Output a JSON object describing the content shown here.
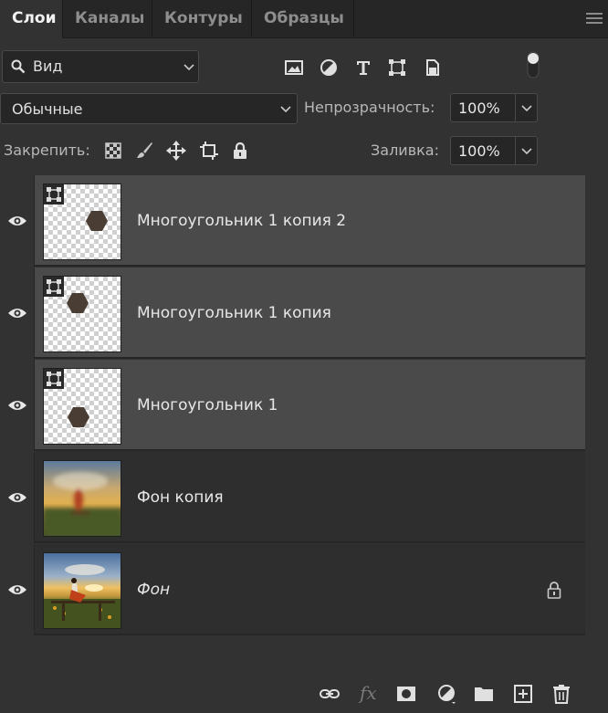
{
  "tabs": [
    {
      "label": "Слои",
      "active": true
    },
    {
      "label": "Каналы",
      "active": false
    },
    {
      "label": "Контуры",
      "active": false
    },
    {
      "label": "Образцы",
      "active": false
    }
  ],
  "filter": {
    "kind_label": "Вид",
    "icons": [
      "image-filter-icon",
      "adjustment-filter-icon",
      "type-filter-icon",
      "shape-filter-icon",
      "smart-object-filter-icon"
    ]
  },
  "blend": {
    "mode": "Обычные",
    "opacity_label": "Непрозрачность:",
    "opacity_value": "100%"
  },
  "lock": {
    "label": "Закрепить:",
    "icons": [
      "lock-transparent-pixels-icon",
      "lock-image-pixels-icon",
      "lock-position-icon",
      "lock-artboard-icon",
      "lock-all-icon"
    ],
    "fill_label": "Заливка:",
    "fill_value": "100%"
  },
  "layers": [
    {
      "name": "Многоугольник 1 копия 2",
      "type": "shape",
      "selected": true,
      "visible": true
    },
    {
      "name": "Многоугольник 1 копия",
      "type": "shape",
      "selected": true,
      "visible": true
    },
    {
      "name": "Многоугольник 1",
      "type": "shape",
      "selected": true,
      "visible": true
    },
    {
      "name": "Фон копия",
      "type": "photo-blurred",
      "selected": false,
      "visible": true
    },
    {
      "name": "Фон",
      "type": "photo",
      "selected": false,
      "visible": true,
      "locked": true
    }
  ],
  "footer": {
    "fx_label": "fx",
    "buttons": [
      "link-layers-icon",
      "fx-icon",
      "add-mask-icon",
      "new-adjustment-icon",
      "new-group-icon",
      "new-layer-icon",
      "delete-layer-icon"
    ]
  },
  "colors": {
    "panel": "#323232",
    "tabbar": "#262626",
    "selected_row": "#4a4a4a",
    "hexagon": "#4a3d33"
  }
}
